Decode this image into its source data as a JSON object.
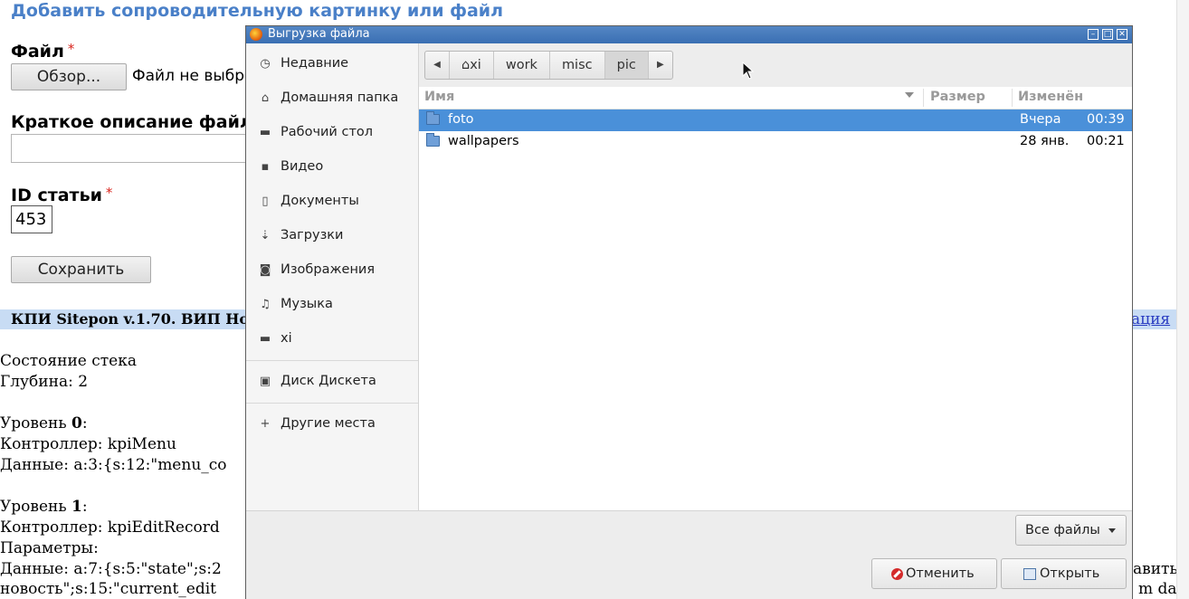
{
  "page": {
    "heading": "Добавить сопроводительную картинку или файл",
    "file_label": "Файл",
    "required_mark": "*",
    "browse_button": "Обзор...",
    "file_status": "Файл не выбр",
    "desc_label": "Краткое описание файл",
    "id_label": "ID статьи",
    "id_value": "453",
    "save_button": "Сохранить",
    "kpi_bar": "КПИ Sitepon v.1.70. ВИП Но",
    "kpi_link": "ация",
    "stack_title": "Состояние стека",
    "depth": "Глубина: 2",
    "level0_label": "Уровень ",
    "level0_num": "0",
    "colon": ":",
    "level0_controller": "Контроллер: kpiMenu",
    "level0_data": "Данные: a:3:{s:12:\"menu_co",
    "level1_label": "Уровень ",
    "level1_num": "1",
    "level1_controller": "Контроллер: kpiEditRecord",
    "level1_params": "Параметры:",
    "level1_data": "Данные: a:7:{s:5:\"state\";s:2",
    "level1_data_right": "авить",
    "level1_data2": "новость\";s:15:\"current_edit",
    "level1_data2_right": "m da"
  },
  "dialog": {
    "title": "Выгрузка файла",
    "sidebar": [
      {
        "icon": "clock-icon",
        "glyph": "◷",
        "label": "Недавние"
      },
      {
        "icon": "home-icon",
        "glyph": "⌂",
        "label": "Домашняя папка"
      },
      {
        "icon": "folder-icon",
        "glyph": "▬",
        "label": "Рабочий стол"
      },
      {
        "icon": "video-icon",
        "glyph": "▪",
        "label": "Видео"
      },
      {
        "icon": "document-icon",
        "glyph": "▯",
        "label": "Документы"
      },
      {
        "icon": "download-icon",
        "glyph": "⇣",
        "label": "Загрузки"
      },
      {
        "icon": "camera-icon",
        "glyph": "◙",
        "label": "Изображения"
      },
      {
        "icon": "music-icon",
        "glyph": "♫",
        "label": "Музыка"
      },
      {
        "icon": "folder-icon",
        "glyph": "▬",
        "label": "xi"
      },
      {
        "icon": "drive-icon",
        "glyph": "▣",
        "label": "Диск Дискета"
      },
      {
        "icon": "plus-icon",
        "glyph": "+",
        "label": "Другие места"
      }
    ],
    "path": [
      "xi",
      "work",
      "misc",
      "pic"
    ],
    "columns": {
      "name": "Имя",
      "size": "Размер",
      "modified": "Изменён"
    },
    "files": [
      {
        "name": "foto",
        "date": "Вчера",
        "time": "00:39",
        "selected": true
      },
      {
        "name": "wallpapers",
        "date": "28 янв.",
        "time": "00:21",
        "selected": false
      }
    ],
    "filter": "Все файлы",
    "cancel": "Отменить",
    "open": "Открыть"
  },
  "colors": {
    "selection": "#4a90d9",
    "titlebar": "#3a6fb3",
    "heading": "#4a80c8"
  }
}
